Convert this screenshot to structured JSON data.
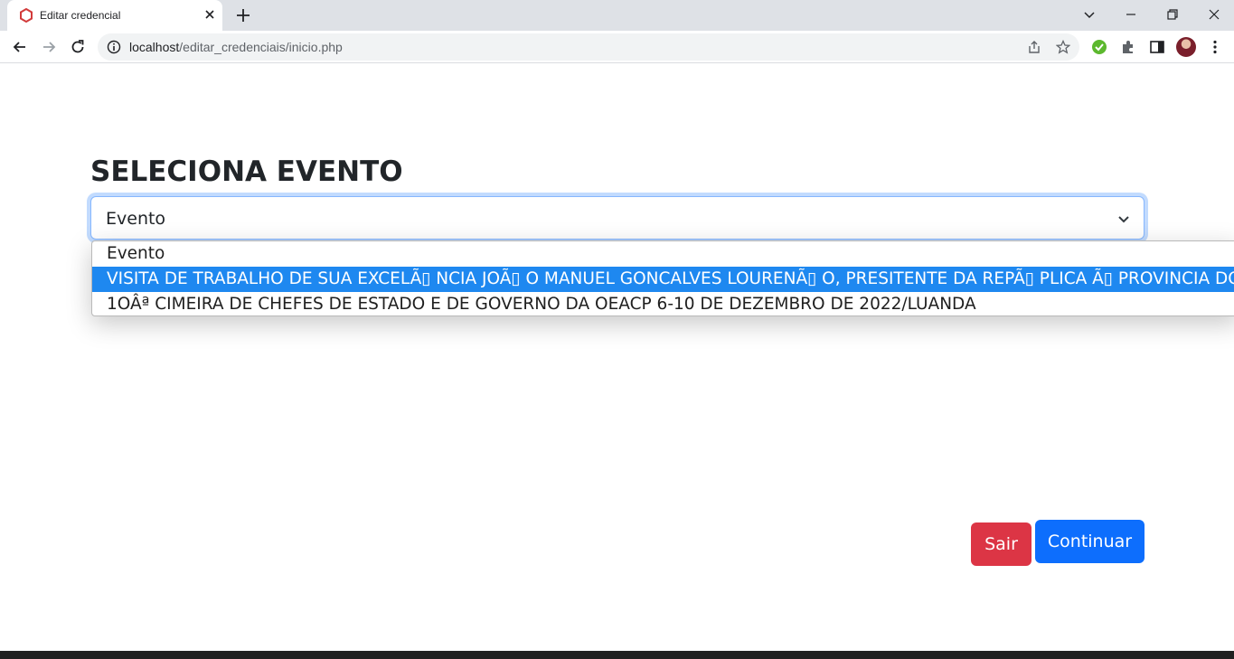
{
  "browser": {
    "tab_title": "Editar credencial",
    "url_host": "localhost",
    "url_path": "/editar_credenciais/inicio.php"
  },
  "page": {
    "title": "SELECIONA EVENTO",
    "select": {
      "selected_value": "Evento",
      "options": [
        "Evento",
        "VISITA DE TRABALHO DE SUA EXCELÃ▯ NCIA JOÃ▯ O MANUEL GONCALVES LOURENÃ▯ O, PRESITENTE DA REPÃ▯ PLICA Ã▯  PROVINCIA DO CU",
        "1OÂª CIMEIRA DE CHEFES DE ESTADO E DE GOVERNO DA OEACP 6-10 DE DEZEMBRO DE 2022/LUANDA"
      ],
      "highlighted_index": 1
    },
    "buttons": {
      "exit": "Sair",
      "continue": "Continuar"
    }
  },
  "colors": {
    "danger": "#dc3545",
    "primary": "#0d6efd",
    "option_highlight": "#1e88f0"
  }
}
